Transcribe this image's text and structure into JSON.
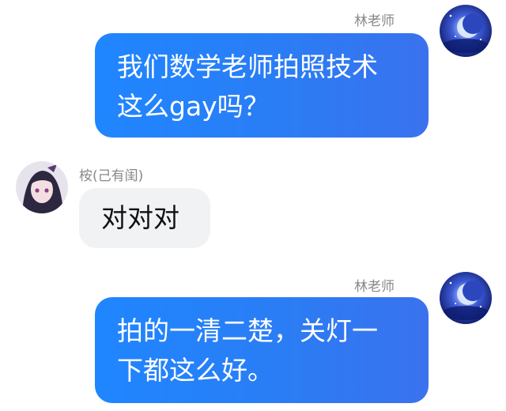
{
  "messages": [
    {
      "side": "right",
      "sender": "林老师",
      "text": "我们数学老师拍照技术\n这么gay吗？",
      "avatar_icon": "moon-night-avatar"
    },
    {
      "side": "left",
      "sender": "桉(己有闺)",
      "text": "对对对",
      "avatar_icon": "anime-girl-avatar"
    },
    {
      "side": "right",
      "sender": "林老师",
      "text": "拍的一清二楚，关灯一\n下都这么好。",
      "avatar_icon": "moon-night-avatar"
    }
  ],
  "colors": {
    "bubble_right": "#2a7df5",
    "bubble_left": "#f1f2f4",
    "sender_name": "#888888"
  }
}
